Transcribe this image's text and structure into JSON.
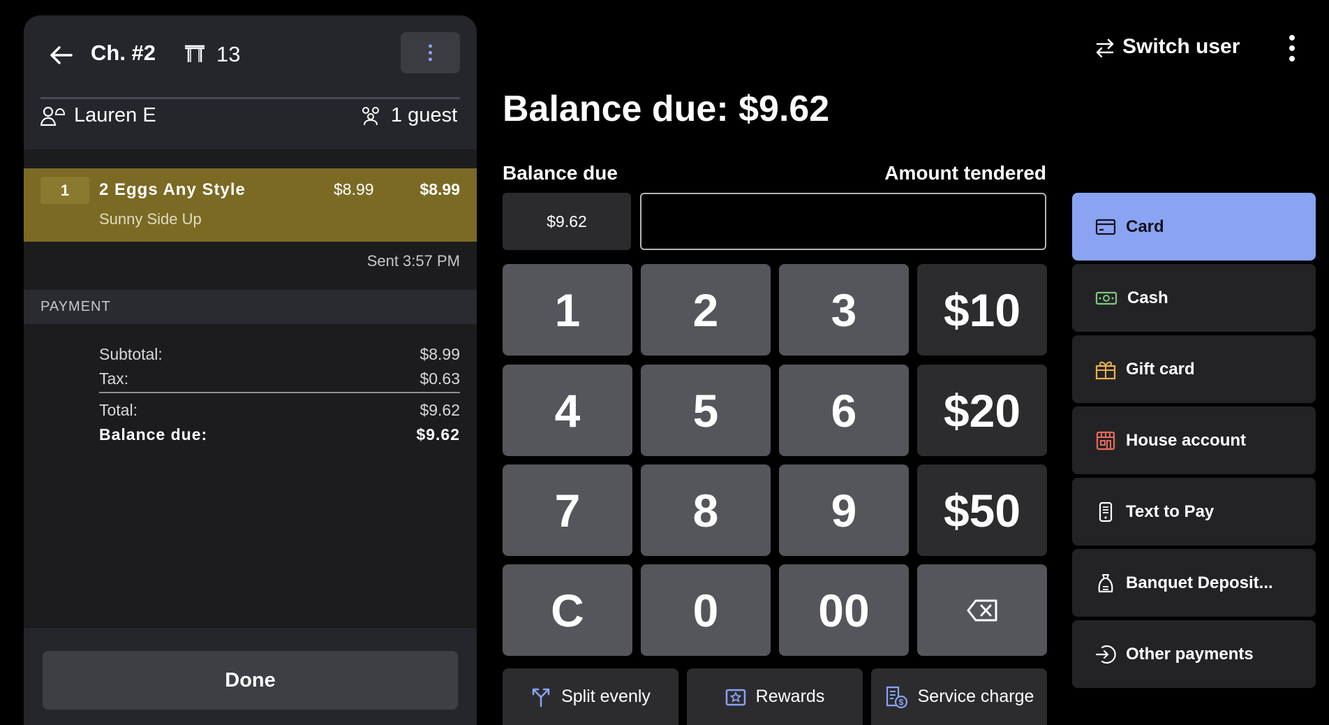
{
  "check": {
    "title": "Ch. #2",
    "table": "13",
    "server": "Lauren E",
    "guests": "1 guest"
  },
  "order": {
    "items": [
      {
        "qty": "1",
        "name": "2 Eggs Any Style",
        "price": "$8.99",
        "total": "$8.99",
        "modifier": "Sunny Side Up"
      }
    ],
    "sent": "Sent 3:57 PM"
  },
  "payment": {
    "section_label": "PAYMENT",
    "subtotal_label": "Subtotal:",
    "subtotal": "$8.99",
    "tax_label": "Tax:",
    "tax": "$0.63",
    "total_label": "Total:",
    "total": "$9.62",
    "balance_label": "Balance due:",
    "balance": "$9.62"
  },
  "done_label": "Done",
  "header": {
    "balance_title": "Balance due: $9.62",
    "switch_user": "Switch user"
  },
  "tender": {
    "balance_due_label": "Balance due",
    "amount_tendered_label": "Amount tendered",
    "balance_due_value": "$9.62",
    "amount_tendered_value": ""
  },
  "keypad": {
    "k1": "1",
    "k2": "2",
    "k3": "3",
    "q10": "$10",
    "k4": "4",
    "k5": "5",
    "k6": "6",
    "q20": "$20",
    "k7": "7",
    "k8": "8",
    "k9": "9",
    "q50": "$50",
    "clear": "C",
    "k0": "0",
    "k00": "00"
  },
  "actions": {
    "split": "Split evenly",
    "rewards": "Rewards",
    "service": "Service charge"
  },
  "payment_methods": {
    "card": "Card",
    "cash": "Cash",
    "gift": "Gift card",
    "house": "House account",
    "text": "Text to Pay",
    "banquet": "Banquet Deposit...",
    "other": "Other payments"
  },
  "colors": {
    "selected_method": "#8aa3f3",
    "item_highlight": "#7a6a24",
    "icon_accent": "#e98a4a",
    "cash_icon": "#7fc97f"
  }
}
